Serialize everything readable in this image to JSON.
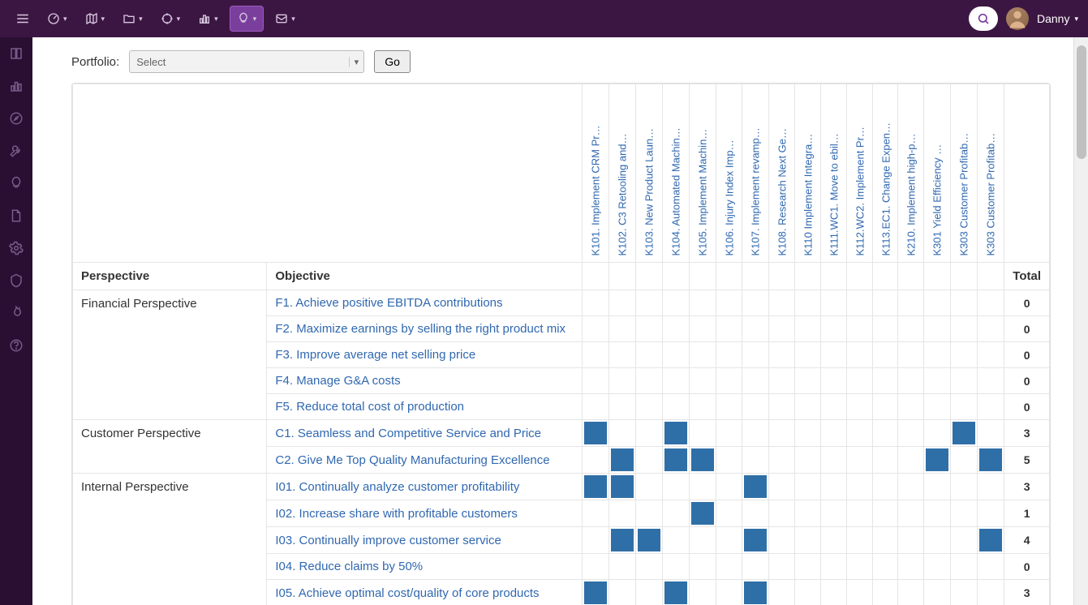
{
  "user": {
    "name": "Danny"
  },
  "select": {
    "placeholder": "Select"
  },
  "labels": {
    "portfolio": "Portfolio:",
    "go": "Go",
    "perspective": "Perspective",
    "objective": "Objective",
    "total": "Total"
  },
  "columns": [
    "K101. Implement CRM Pr…",
    "K102. C3 Retooling and…",
    "K103. New Product Laun…",
    "K104. Automated Machin…",
    "K105. Implement Machin…",
    "K106. Injury Index Imp…",
    "K107. Implement revamp…",
    "K108. Research Next Ge…",
    "K110 Implement Integra…",
    "K111.WC1. Move to ebil…",
    "K112.WC2. Implement Pr…",
    "K113.EC1. Change Expen…",
    "K210. Implement high-p…",
    "K301 Yield Efficiency …",
    "K303 Customer Profitab…",
    "K303 Customer Profitab…"
  ],
  "perspectives": [
    {
      "name": "Financial Perspective",
      "objectives": [
        {
          "label": "F1. Achieve positive EBITDA contributions",
          "marks": [],
          "total": 0
        },
        {
          "label": "F2. Maximize earnings by selling the right product mix",
          "marks": [],
          "total": 0
        },
        {
          "label": "F3. Improve average net selling price",
          "marks": [],
          "total": 0
        },
        {
          "label": "F4. Manage G&A costs",
          "marks": [],
          "total": 0
        },
        {
          "label": "F5. Reduce total cost of production",
          "marks": [],
          "total": 0
        }
      ]
    },
    {
      "name": "Customer Perspective",
      "objectives": [
        {
          "label": "C1. Seamless and Competitive Service and Price",
          "marks": [
            0,
            3,
            14
          ],
          "total": 3
        },
        {
          "label": "C2. Give Me Top Quality Manufacturing Excellence",
          "marks": [
            1,
            3,
            4,
            13,
            15
          ],
          "total": 5
        }
      ]
    },
    {
      "name": "Internal Perspective",
      "objectives": [
        {
          "label": "I01. Continually analyze customer profitability",
          "marks": [
            0,
            1,
            6
          ],
          "total": 3
        },
        {
          "label": "I02. Increase share with profitable customers",
          "marks": [
            4
          ],
          "total": 1
        },
        {
          "label": "I03. Continually improve customer service",
          "marks": [
            1,
            2,
            6,
            15
          ],
          "total": 4
        },
        {
          "label": "I04. Reduce claims by 50%",
          "marks": [],
          "total": 0
        },
        {
          "label": "I05. Achieve optimal cost/quality of core products",
          "marks": [
            0,
            3,
            6
          ],
          "total": 3
        }
      ]
    }
  ]
}
